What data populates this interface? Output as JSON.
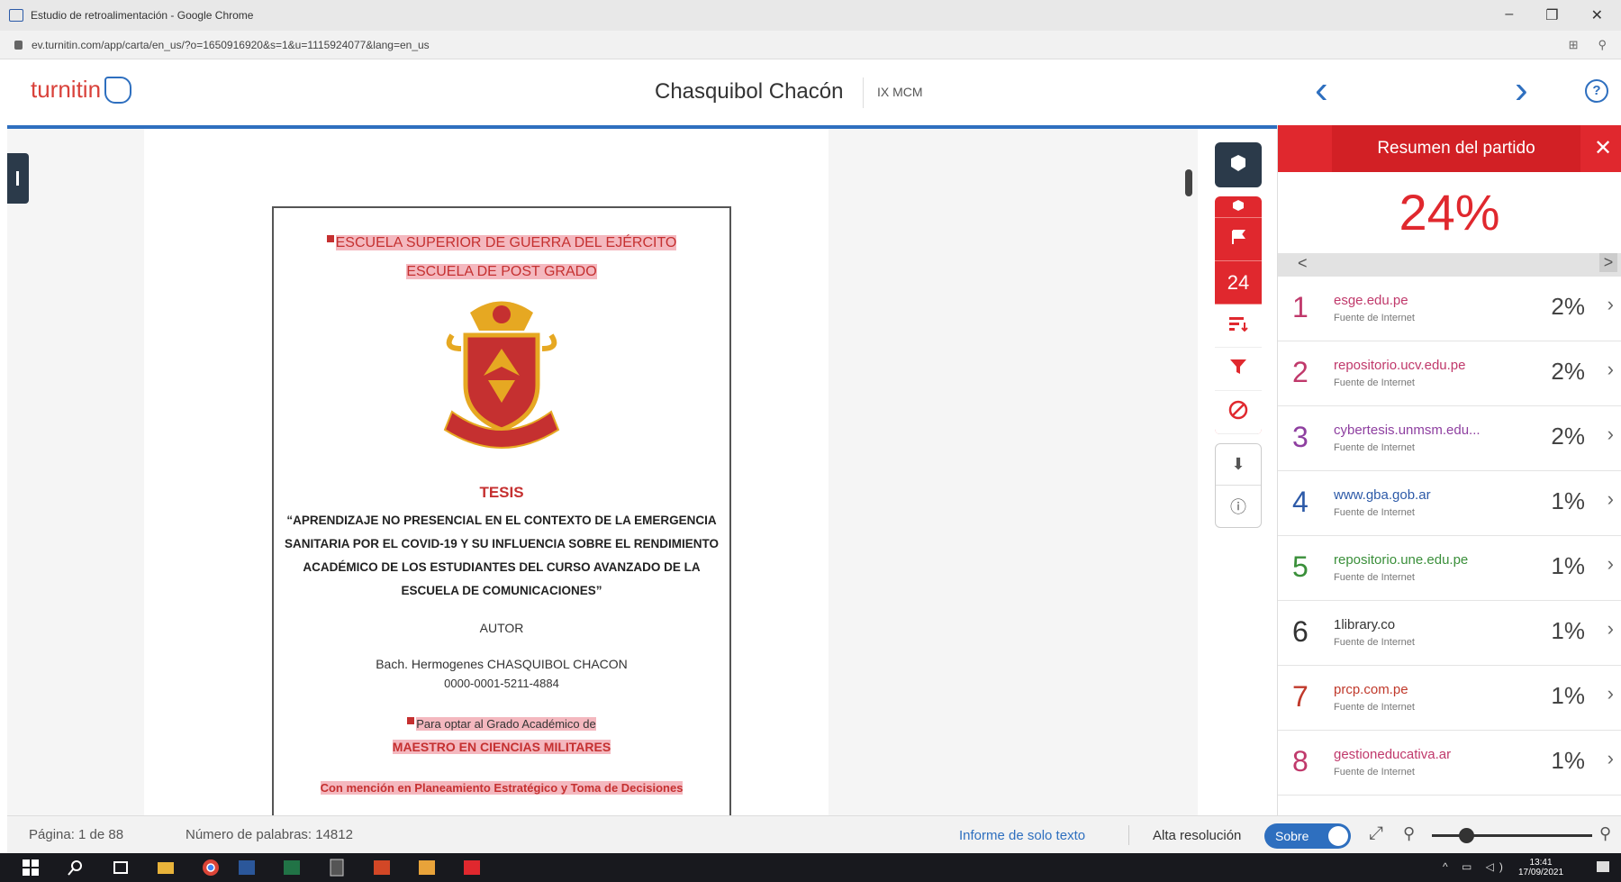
{
  "browser": {
    "window_title": "Estudio de retroalimentación - Google Chrome",
    "url": "ev.turnitin.com/app/carta/en_us/?o=1650916920&s=1&u=1115924077&lang=en_us",
    "controls": [
      "–",
      "❐",
      "✕"
    ]
  },
  "header": {
    "logo_text": "turnitin",
    "doc_title": "Chasquibol Chacón",
    "course": "IX MCM",
    "prev": "‹",
    "next": "›",
    "help": "?"
  },
  "document": {
    "line1": "ESCUELA SUPERIOR DE GUERRA DEL EJÉRCITO",
    "line2": "ESCUELA DE POST GRADO",
    "tesis": "TESIS",
    "title": "“APRENDIZAJE NO PRESENCIAL EN EL CONTEXTO DE LA EMERGENCIA SANITARIA POR EL COVID-19 Y SU INFLUENCIA SOBRE EL RENDIMIENTO ACADÉMICO DE LOS ESTUDIANTES DEL CURSO AVANZADO DE LA ESCUELA DE COMUNICACIONES”",
    "autor_label": "AUTOR",
    "author": "Bach. Hermogenes CHASQUIBOL CHACON",
    "orcid": "0000-0001-5211-4884",
    "optar": "Para optar al Grado Académico de",
    "degree": "MAESTRO EN CIENCIAS MILITARES",
    "mencion": "Con mención en Planeamiento Estratégico y Toma de Decisiones"
  },
  "tools": {
    "match_count": "24",
    "colors": {
      "accent": "#e0282e",
      "dark": "#2b3a4a",
      "link": "#2e6fbf"
    }
  },
  "panel": {
    "title": "Resumen del partido",
    "close": "✕",
    "score": "24%",
    "pager_prev": "<",
    "pager_next": ">",
    "sources": [
      {
        "rank": "1",
        "name": "esge.edu.pe",
        "kind": "Fuente de Internet",
        "pct": "2%",
        "color": "#c0396b"
      },
      {
        "rank": "2",
        "name": "repositorio.ucv.edu.pe",
        "kind": "Fuente de Internet",
        "pct": "2%",
        "color": "#c0396b"
      },
      {
        "rank": "3",
        "name": "cybertesis.unmsm.edu...",
        "kind": "Fuente de Internet",
        "pct": "2%",
        "color": "#8e3fa0"
      },
      {
        "rank": "4",
        "name": "www.gba.gob.ar",
        "kind": "Fuente de Internet",
        "pct": "1%",
        "color": "#2d5aa8"
      },
      {
        "rank": "5",
        "name": "repositorio.une.edu.pe",
        "kind": "Fuente de Internet",
        "pct": "1%",
        "color": "#3a8f3a"
      },
      {
        "rank": "6",
        "name": "1library.co",
        "kind": "Fuente de Internet",
        "pct": "1%",
        "color": "#333333"
      },
      {
        "rank": "7",
        "name": "prcp.com.pe",
        "kind": "Fuente de Internet",
        "pct": "1%",
        "color": "#c0392b"
      },
      {
        "rank": "8",
        "name": "gestioneducativa.ar",
        "kind": "Fuente de Internet",
        "pct": "1%",
        "color": "#c0396b"
      }
    ]
  },
  "status": {
    "page": "Página: 1 de 88",
    "words": "Número de palabras: 14812",
    "text_only": "Informe de solo texto",
    "hires_label": "Alta resolución",
    "toggle": "Sobre"
  },
  "taskbar": {
    "time": "13:41",
    "date": "17/09/2021"
  }
}
